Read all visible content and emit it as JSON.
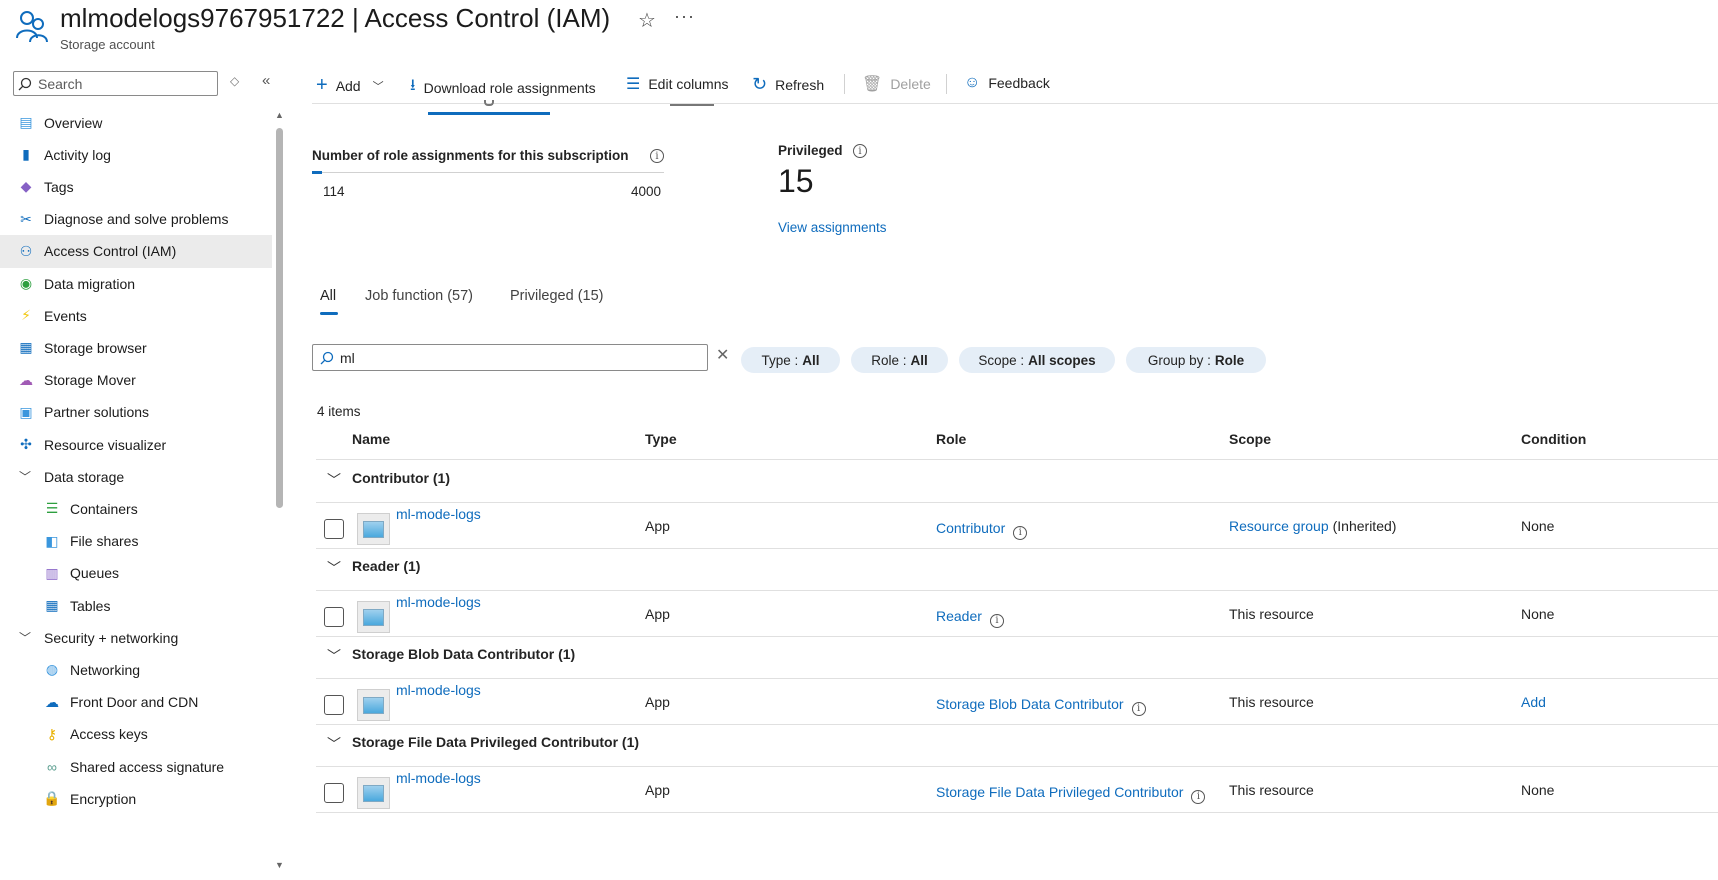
{
  "header": {
    "title": "mlmodelogs9767951722 | Access Control (IAM)",
    "subtitle": "Storage account"
  },
  "sidebar": {
    "search_placeholder": "Search",
    "items": [
      {
        "label": "Overview",
        "icon": "overview-icon"
      },
      {
        "label": "Activity log",
        "icon": "activity-log-icon"
      },
      {
        "label": "Tags",
        "icon": "tag-icon"
      },
      {
        "label": "Diagnose and solve problems",
        "icon": "wrench-icon"
      },
      {
        "label": "Access Control (IAM)",
        "icon": "people-icon",
        "selected": true
      },
      {
        "label": "Data migration",
        "icon": "data-migration-icon"
      },
      {
        "label": "Events",
        "icon": "lightning-icon"
      },
      {
        "label": "Storage browser",
        "icon": "storage-browser-icon"
      },
      {
        "label": "Storage Mover",
        "icon": "cloud-icon"
      },
      {
        "label": "Partner solutions",
        "icon": "partner-icon"
      },
      {
        "label": "Resource visualizer",
        "icon": "visualizer-icon"
      },
      {
        "label": "Data storage",
        "group": true
      },
      {
        "label": "Containers",
        "icon": "containers-icon",
        "child": true
      },
      {
        "label": "File shares",
        "icon": "file-shares-icon",
        "child": true
      },
      {
        "label": "Queues",
        "icon": "queues-icon",
        "child": true
      },
      {
        "label": "Tables",
        "icon": "tables-icon",
        "child": true
      },
      {
        "label": "Security + networking",
        "group": true
      },
      {
        "label": "Networking",
        "icon": "networking-icon",
        "child": true
      },
      {
        "label": "Front Door and CDN",
        "icon": "cdn-icon",
        "child": true
      },
      {
        "label": "Access keys",
        "icon": "key-icon",
        "child": true
      },
      {
        "label": "Shared access signature",
        "icon": "link-icon",
        "child": true
      },
      {
        "label": "Encryption",
        "icon": "lock-icon",
        "child": true
      }
    ]
  },
  "toolbar": {
    "add": "Add",
    "download": "Download role assignments",
    "edit_columns": "Edit columns",
    "refresh": "Refresh",
    "delete": "Delete",
    "feedback": "Feedback"
  },
  "stats": {
    "count_label": "Number of role assignments for this subscription",
    "count_current": "114",
    "count_max": "4000",
    "count_fraction": 0.0285,
    "privileged_label": "Privileged",
    "privileged_value": "15",
    "view_assignments": "View assignments"
  },
  "tabs": [
    {
      "label": "All",
      "active": true
    },
    {
      "label": "Job function (57)"
    },
    {
      "label": "Privileged (15)"
    }
  ],
  "filter": {
    "search_value": "ml",
    "pills": [
      {
        "key": "Type :",
        "value": "All"
      },
      {
        "key": "Role :",
        "value": "All"
      },
      {
        "key": "Scope :",
        "value": "All scopes"
      },
      {
        "key": "Group by :",
        "value": "Role"
      }
    ]
  },
  "grid": {
    "items_count": "4 items",
    "columns": [
      "Name",
      "Type",
      "Role",
      "Scope",
      "Condition"
    ],
    "groups": [
      {
        "label": "Contributor (1)",
        "name": "ml-mode-logs",
        "type": "App",
        "role": "Contributor",
        "scope": "Resource group",
        "scope_suffix": "(Inherited)",
        "condition": "None"
      },
      {
        "label": "Reader (1)",
        "name": "ml-mode-logs",
        "type": "App",
        "role": "Reader",
        "scope": "This resource",
        "condition": "None"
      },
      {
        "label": "Storage Blob Data Contributor (1)",
        "name": "ml-mode-logs",
        "type": "App",
        "role": "Storage Blob Data Contributor",
        "scope": "This resource",
        "condition": "Add"
      },
      {
        "label": "Storage File Data Privileged Contributor (1)",
        "name": "ml-mode-logs",
        "type": "App",
        "role": "Storage File Data Privileged Contributor",
        "scope": "This resource",
        "condition": "None"
      }
    ]
  }
}
